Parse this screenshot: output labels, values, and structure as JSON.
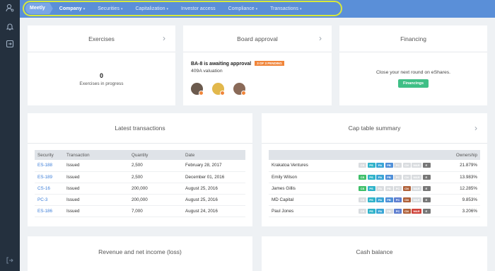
{
  "nav": {
    "brand": "Meetly",
    "items": [
      {
        "label": "Company",
        "active": true,
        "has_menu": true
      },
      {
        "label": "Securities",
        "active": false,
        "has_menu": true
      },
      {
        "label": "Capitalization",
        "active": false,
        "has_menu": true
      },
      {
        "label": "Investor access",
        "active": false,
        "has_menu": false
      },
      {
        "label": "Compliance",
        "active": false,
        "has_menu": true
      },
      {
        "label": "Transactions",
        "active": false,
        "has_menu": true
      }
    ],
    "caret": "▾"
  },
  "sidebar_icons": [
    "user-search-icon",
    "bell-icon",
    "exit-icon",
    "logout-icon"
  ],
  "exercises": {
    "title": "Exercises",
    "count": "0",
    "caption": "Exercises in progress"
  },
  "board_approval": {
    "title": "Board approval",
    "item": "BA-8 is awaiting approval",
    "pending_badge": "3 OF 3 PENDING",
    "subtitle": "409A valuation",
    "approver_avatars": 3
  },
  "financing": {
    "title": "Financing",
    "message": "Close your next round on eShares.",
    "button": "Financings"
  },
  "latest_transactions": {
    "title": "Latest transactions",
    "columns": [
      "Security",
      "Transaction",
      "Quantity",
      "Date"
    ],
    "rows": [
      [
        "ES-188",
        "Issued",
        "2,500",
        "February 28, 2017"
      ],
      [
        "ES-189",
        "Issued",
        "2,500",
        "December 01, 2016"
      ],
      [
        "CS-16",
        "Issued",
        "200,000",
        "August 25, 2016"
      ],
      [
        "PC-3",
        "Issued",
        "200,000",
        "August 25, 2016"
      ],
      [
        "ES-186",
        "Issued",
        "7,000",
        "August 24, 2016"
      ]
    ]
  },
  "cap_table": {
    "title": "Cap table summary",
    "ownership_header": "Ownership",
    "tag_labels": [
      "CS",
      "PS",
      "PA",
      "PB",
      "PC",
      "CN",
      "WAR",
      "E"
    ],
    "tag_colors": {
      "CS": "#3fbf6a",
      "PS": "#2fb3c9",
      "PA": "#3aa6d6",
      "PB": "#4f8fd8",
      "PC": "#5f7fd0",
      "CN": "#b0613a",
      "WAR": "#d0443c",
      "E": "#777777"
    },
    "rows": [
      {
        "name": "Krakatoa Ventures",
        "ownership": "21.879%",
        "active": [
          "PS",
          "PA",
          "PB",
          "E"
        ]
      },
      {
        "name": "Emily Wilson",
        "ownership": "13.983%",
        "active": [
          "CS",
          "PS",
          "PA",
          "PB",
          "E"
        ]
      },
      {
        "name": "James Gillis",
        "ownership": "12.285%",
        "active": [
          "CS",
          "PS",
          "CN",
          "E"
        ]
      },
      {
        "name": "MD Capital",
        "ownership": "9.853%",
        "active": [
          "PS",
          "PA",
          "PB",
          "PC",
          "CN",
          "E"
        ]
      },
      {
        "name": "Paul Jones",
        "ownership": "3.206%",
        "active": [
          "PS",
          "PA",
          "PC",
          "CN",
          "WAR",
          "E"
        ]
      }
    ]
  },
  "revenue": {
    "title": "Revenue and net income (loss)"
  },
  "cash_balance": {
    "title": "Cash balance"
  }
}
